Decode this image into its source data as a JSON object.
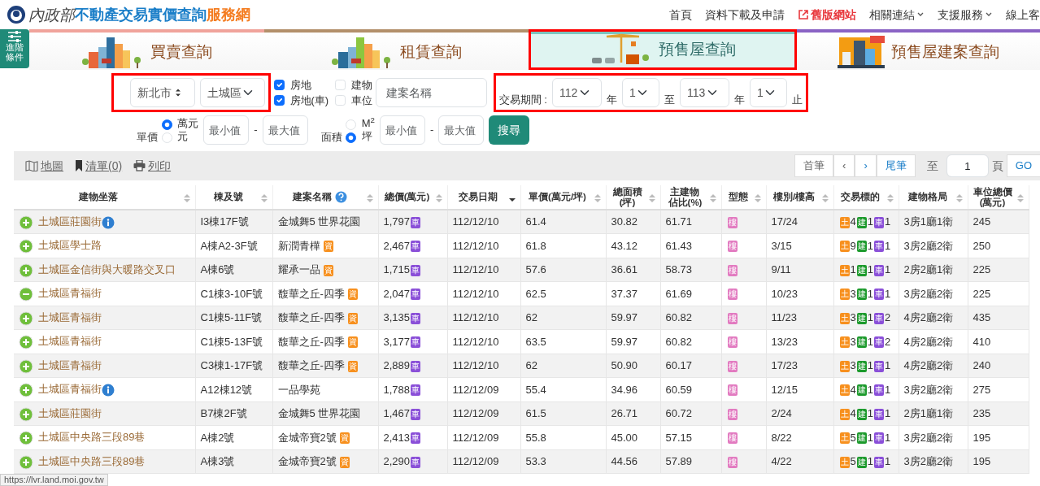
{
  "header": {
    "logo": {
      "ministry": "內政部",
      "title": "不動產交易實價查詢",
      "suffix": "服務網"
    },
    "nav": [
      {
        "label": "首頁",
        "kind": "plain"
      },
      {
        "label": "資料下載及申請",
        "kind": "plain"
      },
      {
        "label": "舊版網站",
        "kind": "external"
      },
      {
        "label": "相關連結",
        "kind": "dropdown"
      },
      {
        "label": "支援服務",
        "kind": "dropdown"
      },
      {
        "label": "線上客",
        "kind": "plain"
      }
    ]
  },
  "advanced_button": "進階條件",
  "tabs": [
    {
      "label": "買賣查詢",
      "kind": "sale",
      "selected": false,
      "highlighted": false,
      "color": "#f0a39b"
    },
    {
      "label": "租賃查詢",
      "kind": "rent",
      "selected": false,
      "highlighted": false,
      "color": "#b3906b"
    },
    {
      "label": "預售屋查詢",
      "kind": "presale",
      "selected": true,
      "highlighted": true,
      "color": "#7cc4bf"
    },
    {
      "label": "預售屋建案查詢",
      "kind": "project",
      "selected": false,
      "highlighted": false,
      "color": "#8a63c4"
    }
  ],
  "filters": {
    "location": {
      "highlighted": true,
      "city": "新北市",
      "district": "土城區"
    },
    "checkboxes": [
      {
        "label": "房地",
        "checked": true
      },
      {
        "label": "建物",
        "checked": false
      },
      {
        "label": "房地(車)",
        "checked": true
      },
      {
        "label": "車位",
        "checked": false
      }
    ],
    "project": {
      "placeholder": "建案名稱"
    },
    "period": {
      "highlighted": true,
      "label": "交易期間 :",
      "parts": [
        {
          "kind": "select",
          "value": "112"
        },
        {
          "kind": "text",
          "text": "年"
        },
        {
          "kind": "select",
          "value": "1"
        },
        {
          "kind": "text",
          "text": "至"
        },
        {
          "kind": "select",
          "value": "113"
        },
        {
          "kind": "text",
          "text": "年"
        },
        {
          "kind": "select",
          "value": "1"
        },
        {
          "kind": "text",
          "text": "止"
        }
      ]
    },
    "price": {
      "label": "單價",
      "units": [
        {
          "label": "萬元",
          "selected": true
        },
        {
          "label": "元",
          "selected": false
        }
      ],
      "min": {
        "placeholder": "最小值"
      },
      "dash": "-",
      "max": {
        "placeholder": "最大值"
      }
    },
    "area": {
      "label": "面積",
      "units": [
        {
          "label": "M$^{2}$",
          "selected": false
        },
        {
          "label": "坪",
          "selected": true
        }
      ],
      "min": {
        "placeholder": "最小值"
      },
      "dash": "-",
      "max": {
        "placeholder": "最大值"
      }
    },
    "search_button": "搜尋"
  },
  "toolbar": {
    "actions": [
      {
        "label": "地圖",
        "kind": "map"
      },
      {
        "label": "清單(0)",
        "kind": "list"
      },
      {
        "label": "列印",
        "kind": "print"
      }
    ],
    "pager": {
      "first": "首筆",
      "prev": "‹",
      "next": "›",
      "last": "尾筆",
      "to": "至",
      "page": "1",
      "page_unit": "頁",
      "go": "GO"
    }
  },
  "table": {
    "columns": [
      {
        "label": "建物坐落",
        "sorted": false,
        "help": false
      },
      {
        "label": "棟及號",
        "sorted": false,
        "help": false
      },
      {
        "label": "建案名稱",
        "sorted": false,
        "help": true
      },
      {
        "label": "總價(萬元)",
        "sorted": false,
        "help": false
      },
      {
        "label": "交易日期",
        "sorted": true,
        "help": false
      },
      {
        "label": "單價(萬元/坪)",
        "sorted": false,
        "help": false
      },
      {
        "lines": [
          "總面積",
          "(坪)"
        ],
        "sorted": false,
        "help": false
      },
      {
        "lines": [
          "主建物",
          "佔比(%)"
        ],
        "sorted": false,
        "help": false
      },
      {
        "label": "型態",
        "sorted": false,
        "help": false
      },
      {
        "label": "樓別/樓高",
        "sorted": false,
        "help": false
      },
      {
        "label": "交易標的",
        "sorted": false,
        "help": false
      },
      {
        "label": "建物格局",
        "sorted": false,
        "help": false
      },
      {
        "lines": [
          "車位總價",
          "(萬元)"
        ],
        "sorted": false,
        "help": false
      }
    ],
    "rows": [
      {
        "location": "土城區莊園街",
        "info": true,
        "expanded": false,
        "unit": "I3棟17F號",
        "project": "金城舞5 世界花園",
        "total": "1,797",
        "total_tag": "車",
        "date": "112/12/10",
        "unit_price": "61.4",
        "area": "30.82",
        "main_ratio": "61.71",
        "type": "樓",
        "floor": "17/24",
        "targets": [
          {
            "label": "土",
            "count": "4",
            "color": "#f7901e"
          },
          {
            "label": "建",
            "count": "1",
            "color": "#1c9a2c"
          },
          {
            "label": "車",
            "count": "1",
            "color": "#8a4fd8"
          }
        ],
        "layout": "3房1廳1衛",
        "parking_price": "245"
      },
      {
        "location": "土城區學士路",
        "info": false,
        "expanded": false,
        "unit": "A棟A2-3F號",
        "project": "新潤青樺",
        "project_tag": "資",
        "total": "2,467",
        "total_tag": "車",
        "date": "112/12/10",
        "unit_price": "61.8",
        "area": "43.12",
        "main_ratio": "61.43",
        "type": "樓",
        "floor": "3/15",
        "targets": [
          {
            "label": "土",
            "count": "9",
            "color": "#f7901e"
          },
          {
            "label": "建",
            "count": "1",
            "color": "#1c9a2c"
          },
          {
            "label": "車",
            "count": "1",
            "color": "#8a4fd8"
          }
        ],
        "layout": "3房2廳2衛",
        "parking_price": "250"
      },
      {
        "location": "土城區金信街與大暖路交叉口",
        "info": false,
        "expanded": false,
        "unit": "A棟6號",
        "project": "耀承一品",
        "project_tag": "資",
        "total": "1,715",
        "total_tag": "車",
        "date": "112/12/10",
        "unit_price": "57.6",
        "area": "36.61",
        "main_ratio": "58.73",
        "type": "樓",
        "floor": "9/11",
        "targets": [
          {
            "label": "土",
            "count": "1",
            "color": "#f7901e"
          },
          {
            "label": "建",
            "count": "1",
            "color": "#1c9a2c"
          },
          {
            "label": "車",
            "count": "1",
            "color": "#8a4fd8"
          }
        ],
        "layout": "2房2廳1衛",
        "parking_price": "225"
      },
      {
        "location": "土城區青福街",
        "info": false,
        "expanded": true,
        "unit": "C1棟3-10F號",
        "project": "馥華之丘-四季",
        "project_tag": "資",
        "total": "2,047",
        "total_tag": "車",
        "date": "112/12/10",
        "unit_price": "62.5",
        "area": "37.37",
        "main_ratio": "61.69",
        "type": "樓",
        "floor": "10/23",
        "targets": [
          {
            "label": "土",
            "count": "3",
            "color": "#f7901e"
          },
          {
            "label": "建",
            "count": "1",
            "color": "#1c9a2c"
          },
          {
            "label": "車",
            "count": "1",
            "color": "#8a4fd8"
          }
        ],
        "layout": "3房2廳2衛",
        "parking_price": "225"
      },
      {
        "location": "土城區青福街",
        "info": false,
        "expanded": false,
        "unit": "C1棟5-11F號",
        "project": "馥華之丘-四季",
        "project_tag": "資",
        "total": "3,135",
        "total_tag": "車",
        "date": "112/12/10",
        "unit_price": "62",
        "area": "59.97",
        "main_ratio": "60.82",
        "type": "樓",
        "floor": "11/23",
        "targets": [
          {
            "label": "土",
            "count": "3",
            "color": "#f7901e"
          },
          {
            "label": "建",
            "count": "1",
            "color": "#1c9a2c"
          },
          {
            "label": "車",
            "count": "2",
            "color": "#8a4fd8"
          }
        ],
        "layout": "4房2廳2衛",
        "parking_price": "435"
      },
      {
        "location": "土城區青福街",
        "info": false,
        "expanded": false,
        "unit": "C1棟5-13F號",
        "project": "馥華之丘-四季",
        "project_tag": "資",
        "total": "3,177",
        "total_tag": "車",
        "date": "112/12/10",
        "unit_price": "63.5",
        "area": "59.97",
        "main_ratio": "60.82",
        "type": "樓",
        "floor": "13/23",
        "targets": [
          {
            "label": "土",
            "count": "3",
            "color": "#f7901e"
          },
          {
            "label": "建",
            "count": "1",
            "color": "#1c9a2c"
          },
          {
            "label": "車",
            "count": "2",
            "color": "#8a4fd8"
          }
        ],
        "layout": "4房2廳2衛",
        "parking_price": "410"
      },
      {
        "location": "土城區青福街",
        "info": false,
        "expanded": false,
        "unit": "C3棟1-17F號",
        "project": "馥華之丘-四季",
        "project_tag": "資",
        "total": "2,889",
        "total_tag": "車",
        "date": "112/12/10",
        "unit_price": "62",
        "area": "50.90",
        "main_ratio": "60.17",
        "type": "樓",
        "floor": "17/23",
        "targets": [
          {
            "label": "土",
            "count": "3",
            "color": "#f7901e"
          },
          {
            "label": "建",
            "count": "1",
            "color": "#1c9a2c"
          },
          {
            "label": "車",
            "count": "1",
            "color": "#8a4fd8"
          }
        ],
        "layout": "4房2廳2衛",
        "parking_price": "240"
      },
      {
        "location": "土城區青福街",
        "info": true,
        "expanded": false,
        "unit": "A12棟12號",
        "project": "一品學苑",
        "total": "1,788",
        "total_tag": "車",
        "date": "112/12/09",
        "unit_price": "55.4",
        "area": "34.96",
        "main_ratio": "60.59",
        "type": "樓",
        "floor": "12/15",
        "targets": [
          {
            "label": "土",
            "count": "4",
            "color": "#f7901e"
          },
          {
            "label": "建",
            "count": "1",
            "color": "#1c9a2c"
          },
          {
            "label": "車",
            "count": "1",
            "color": "#8a4fd8"
          }
        ],
        "layout": "3房2廳2衛",
        "parking_price": "275"
      },
      {
        "location": "土城區莊園街",
        "info": false,
        "expanded": false,
        "unit": "B7棟2F號",
        "project": "金城舞5 世界花園",
        "total": "1,467",
        "total_tag": "車",
        "date": "112/12/09",
        "unit_price": "61.5",
        "area": "26.71",
        "main_ratio": "60.72",
        "type": "樓",
        "floor": "2/24",
        "targets": [
          {
            "label": "土",
            "count": "4",
            "color": "#f7901e"
          },
          {
            "label": "建",
            "count": "1",
            "color": "#1c9a2c"
          },
          {
            "label": "車",
            "count": "1",
            "color": "#8a4fd8"
          }
        ],
        "layout": "2房1廳1衛",
        "parking_price": "235"
      },
      {
        "location": "土城區中央路三段89巷",
        "info": false,
        "expanded": false,
        "unit": "A棟2號",
        "project": "金城帝寶2號",
        "project_tag": "資",
        "total": "2,413",
        "total_tag": "車",
        "date": "112/12/09",
        "unit_price": "55.8",
        "area": "45.00",
        "main_ratio": "57.15",
        "type": "樓",
        "floor": "8/22",
        "targets": [
          {
            "label": "土",
            "count": "5",
            "color": "#f7901e"
          },
          {
            "label": "建",
            "count": "1",
            "color": "#1c9a2c"
          },
          {
            "label": "車",
            "count": "1",
            "color": "#8a4fd8"
          }
        ],
        "layout": "3房2廳2衛",
        "parking_price": "195"
      },
      {
        "location": "土城區中央路三段89巷",
        "info": false,
        "expanded": false,
        "unit": "A棟3號",
        "project": "金城帝寶2號",
        "project_tag": "資",
        "total": "2,290",
        "total_tag": "車",
        "date": "112/12/09",
        "unit_price": "53.3",
        "area": "44.56",
        "main_ratio": "57.89",
        "type": "樓",
        "floor": "4/22",
        "targets": [
          {
            "label": "土",
            "count": "5",
            "color": "#f7901e"
          },
          {
            "label": "建",
            "count": "1",
            "color": "#1c9a2c"
          },
          {
            "label": "車",
            "count": "1",
            "color": "#8a4fd8"
          }
        ],
        "layout": "3房2廳2衛",
        "parking_price": "195"
      }
    ]
  },
  "status_bar": "https://lvr.land.moi.gov.tw"
}
